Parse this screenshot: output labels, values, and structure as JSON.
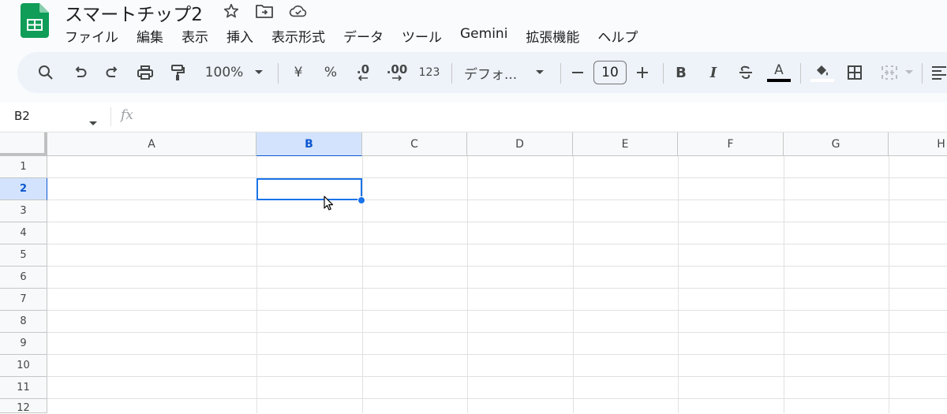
{
  "document": {
    "title": "スマートチップ2"
  },
  "menu": [
    "ファイル",
    "編集",
    "表示",
    "挿入",
    "表示形式",
    "データ",
    "ツール",
    "Gemini",
    "拡張機能",
    "ヘルプ"
  ],
  "toolbar": {
    "zoom": "100%",
    "currency": "¥",
    "percent": "%",
    "decrease_decimal": ".0",
    "increase_decimal": ".00",
    "number_format": "123",
    "font": "デフォ...",
    "font_size": "10",
    "bold": "B",
    "italic": "I",
    "text_color_letter": "A"
  },
  "formula_bar": {
    "name_box": "B2",
    "fx": "fx"
  },
  "sheet": {
    "columns": [
      "A",
      "B",
      "C",
      "D",
      "E",
      "F",
      "G",
      "H"
    ],
    "rows": [
      "1",
      "2",
      "3",
      "4",
      "5",
      "6",
      "7",
      "8",
      "9",
      "10",
      "11",
      "12"
    ],
    "selected_cell": "B2",
    "selected_column": "B",
    "selected_row": "2"
  },
  "colors": {
    "sheets_green": "#0f9d58",
    "selection_blue": "#1a73e8",
    "header_selected_bg": "#d3e3fd"
  }
}
